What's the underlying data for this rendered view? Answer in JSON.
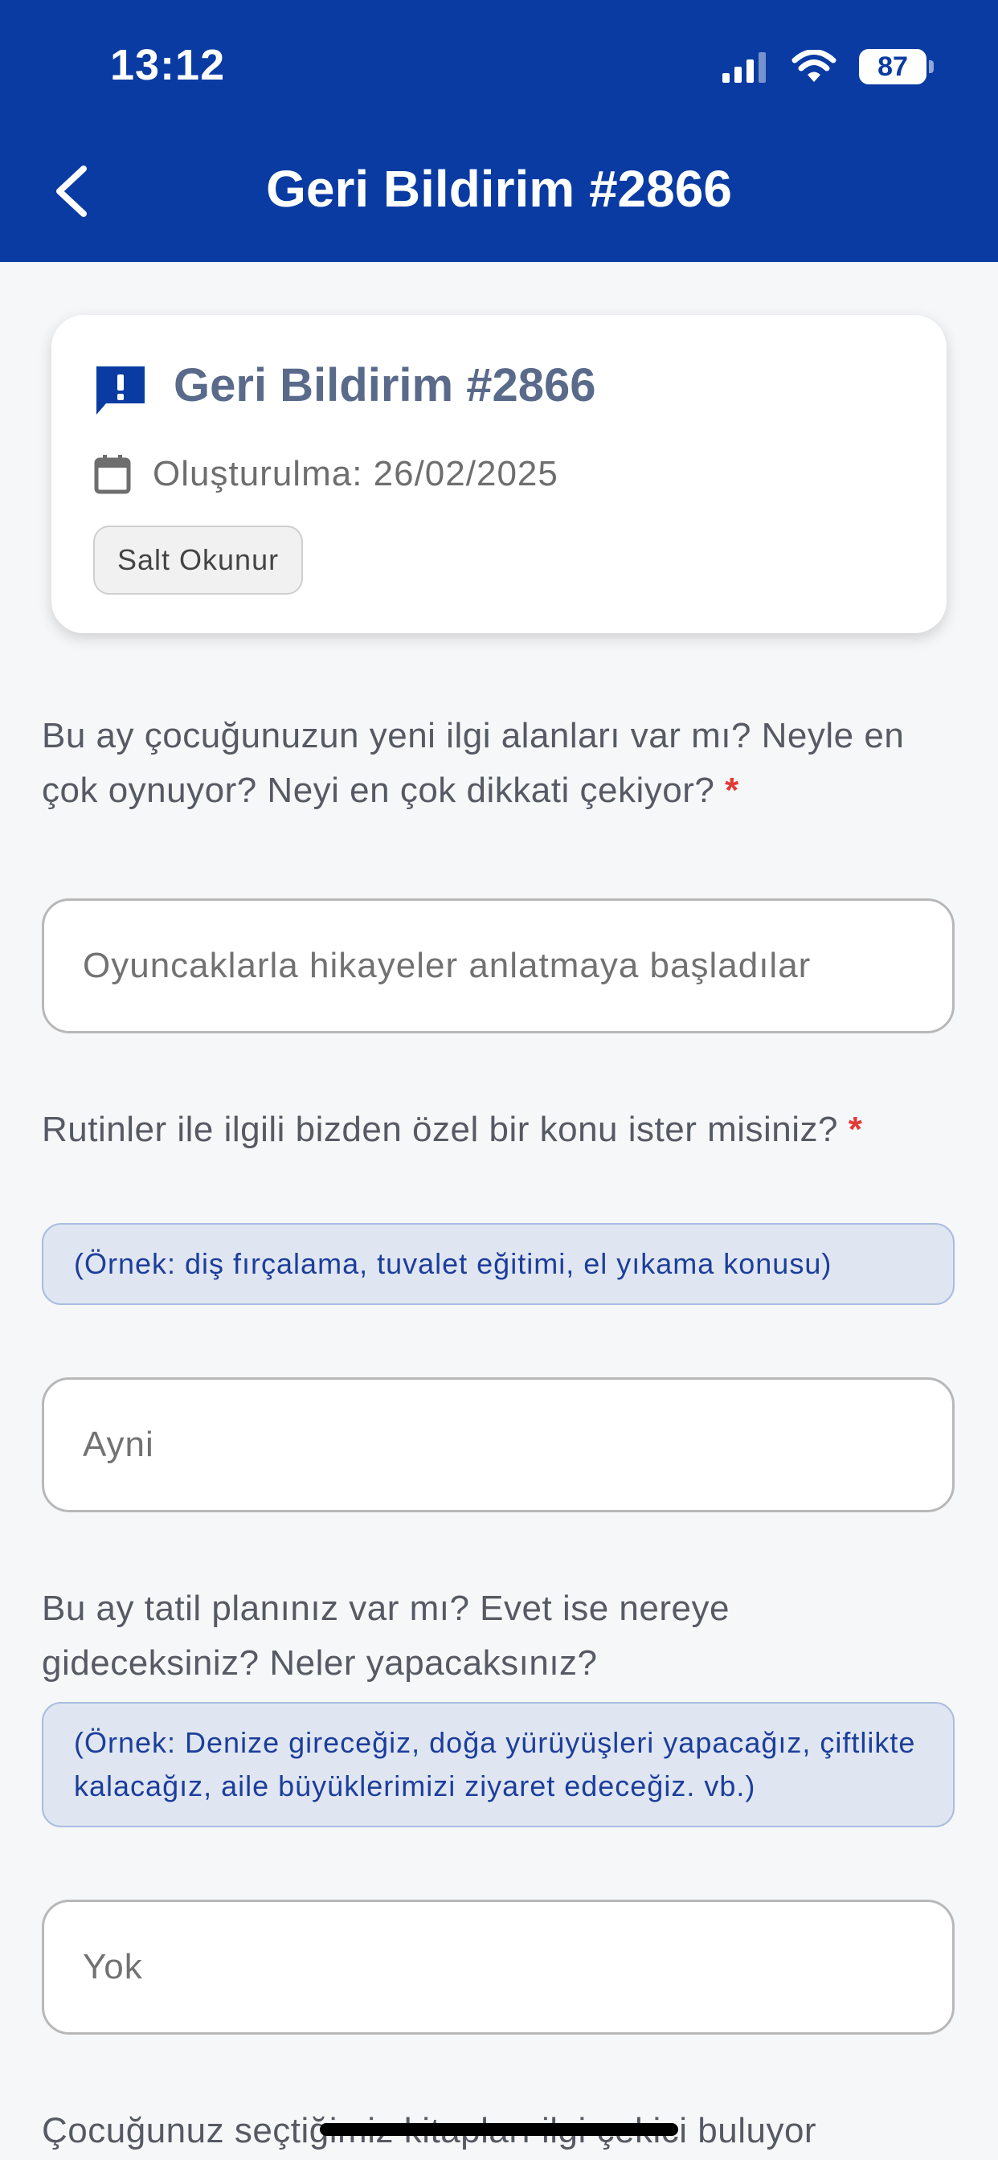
{
  "status_bar": {
    "time": "13:12",
    "battery": "87"
  },
  "nav": {
    "title": "Geri Bildirim #2866"
  },
  "card": {
    "title": "Geri Bildirim #2866",
    "created": "Oluşturulma: 26/02/2025",
    "badge": "Salt Okunur"
  },
  "questions": [
    {
      "text": "Bu ay çocuğunuzun yeni ilgi alanları var mı? Neyle en çok oynuyor? Neyi en çok dikkati çekiyor?",
      "required": "*",
      "answer": "Oyuncaklarla hikayeler anlatmaya başladılar"
    },
    {
      "text": "Rutinler ile ilgili bizden özel bir konu ister misiniz?",
      "required": "*",
      "hint": "(Örnek: diş fırçalama, tuvalet eğitimi, el yıkama konusu)",
      "answer": "Ayni"
    },
    {
      "text": "Bu ay tatil planınız var mı? Evet ise nereye gideceksiniz? Neler yapacaksınız?",
      "hint": "(Örnek: Denize gireceğiz, doğa yürüyüşleri yapacağız, çiftlikte kalacağız, aile büyüklerimizi ziyaret edeceğiz. vb.)",
      "answer": "Yok"
    },
    {
      "text": "Çocuğunuz seçtiğimiz kitapları ilgi çekici buluyor"
    }
  ],
  "colors": {
    "header_bg": "#0a3ba3",
    "required": "#e53935",
    "hint_bg": "#e0e6f1",
    "hint_text": "#1c3e9b"
  }
}
